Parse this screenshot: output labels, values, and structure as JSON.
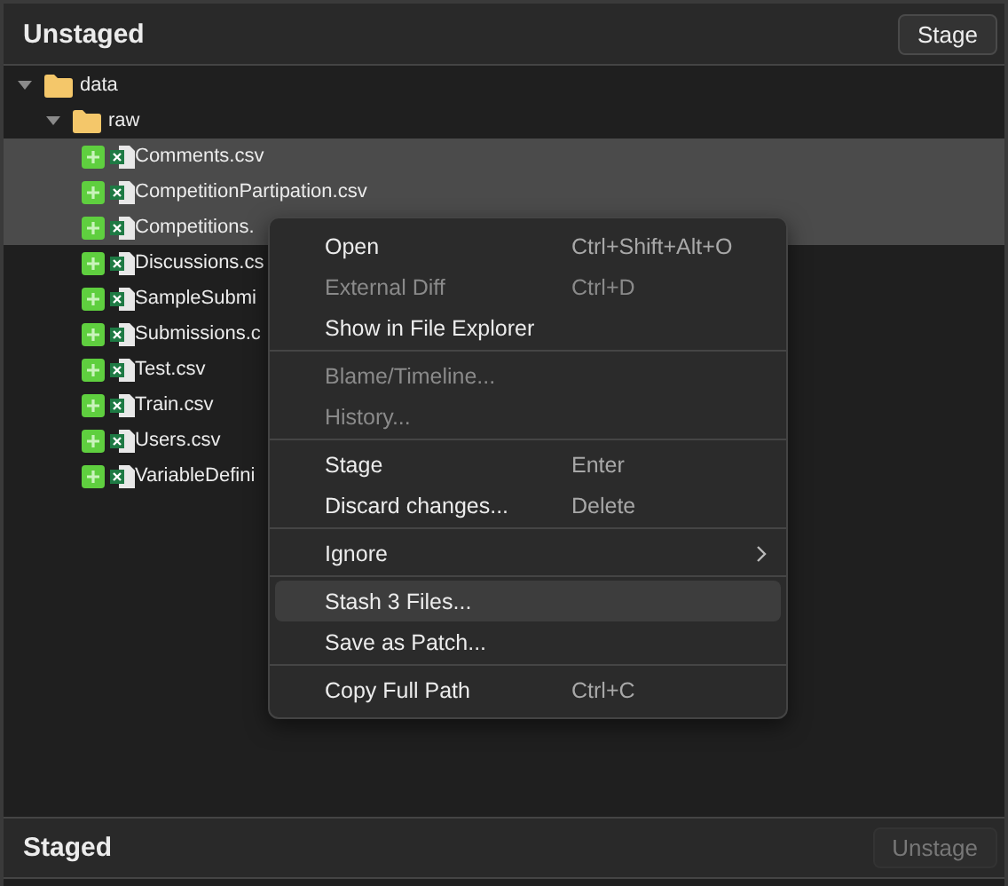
{
  "unstaged": {
    "title": "Unstaged",
    "button": {
      "label": "Stage",
      "disabled": false
    },
    "tree": [
      {
        "kind": "folder",
        "name": "data",
        "expanded": true,
        "children": [
          {
            "kind": "folder",
            "name": "raw",
            "expanded": true,
            "children": [
              {
                "kind": "file",
                "name": "Comments.csv",
                "selected": true
              },
              {
                "kind": "file",
                "name": "CompetitionPartipation.csv",
                "selected": true
              },
              {
                "kind": "file",
                "name": "Competitions.",
                "selected": true
              },
              {
                "kind": "file",
                "name": "Discussions.cs",
                "selected": false
              },
              {
                "kind": "file",
                "name": "SampleSubmi",
                "selected": false
              },
              {
                "kind": "file",
                "name": "Submissions.c",
                "selected": false
              },
              {
                "kind": "file",
                "name": "Test.csv",
                "selected": false
              },
              {
                "kind": "file",
                "name": "Train.csv",
                "selected": false
              },
              {
                "kind": "file",
                "name": "Users.csv",
                "selected": false
              },
              {
                "kind": "file",
                "name": "VariableDefini",
                "selected": false
              }
            ]
          }
        ]
      }
    ]
  },
  "context_menu": [
    {
      "kind": "item",
      "label": "Open",
      "shortcut": "Ctrl+Shift+Alt+O",
      "disabled": false,
      "selected": false
    },
    {
      "kind": "item",
      "label": "External Diff",
      "shortcut": "Ctrl+D",
      "disabled": true,
      "selected": false
    },
    {
      "kind": "item",
      "label": "Show in File Explorer",
      "disabled": false,
      "selected": false
    },
    {
      "kind": "separator"
    },
    {
      "kind": "item",
      "label": "Blame/Timeline...",
      "disabled": true,
      "selected": false
    },
    {
      "kind": "item",
      "label": "History...",
      "disabled": true,
      "selected": false
    },
    {
      "kind": "separator"
    },
    {
      "kind": "item",
      "label": "Stage",
      "shortcut": "Enter",
      "disabled": false,
      "selected": false
    },
    {
      "kind": "item",
      "label": "Discard changes...",
      "shortcut": "Delete",
      "disabled": false,
      "selected": false
    },
    {
      "kind": "separator"
    },
    {
      "kind": "submenu",
      "label": "Ignore",
      "disabled": false,
      "selected": false
    },
    {
      "kind": "separator"
    },
    {
      "kind": "item",
      "label": "Stash 3 Files...",
      "disabled": false,
      "selected": true
    },
    {
      "kind": "item",
      "label": "Save as Patch...",
      "disabled": false,
      "selected": false
    },
    {
      "kind": "separator"
    },
    {
      "kind": "item",
      "label": "Copy Full Path",
      "shortcut": "Ctrl+C",
      "disabled": false,
      "selected": false
    }
  ],
  "staged": {
    "title": "Staged",
    "button": {
      "label": "Unstage",
      "disabled": true
    }
  }
}
